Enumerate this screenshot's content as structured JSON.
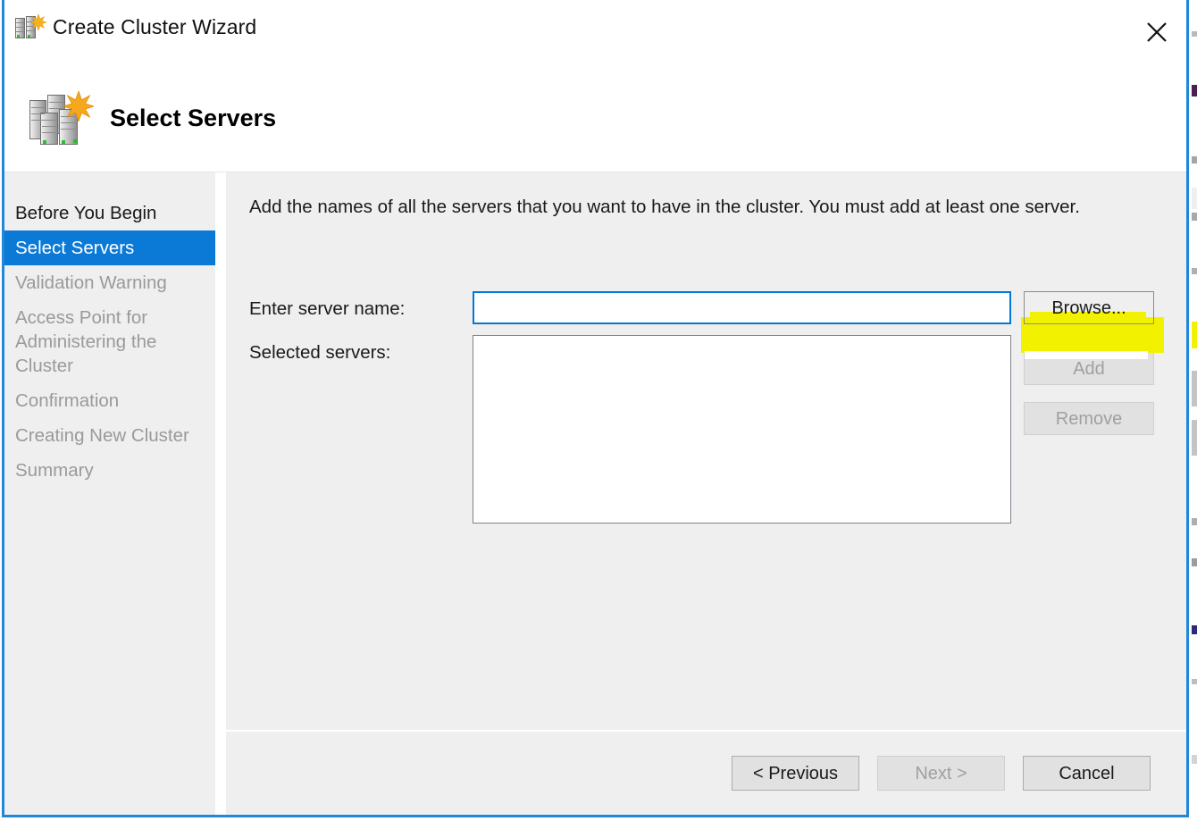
{
  "window": {
    "title": "Create Cluster Wizard",
    "title_icon": "cluster-servers-icon",
    "close_icon": "close-icon",
    "border_color": "#1f89d8"
  },
  "banner": {
    "heading": "Select Servers",
    "icon": "cluster-servers-large-icon"
  },
  "sidebar": {
    "items": [
      {
        "label": "Before You Begin",
        "state": "done"
      },
      {
        "label": "Select Servers",
        "state": "current"
      },
      {
        "label": "Validation Warning",
        "state": "pending"
      },
      {
        "label": "Access Point for Administering the Cluster",
        "state": "pending"
      },
      {
        "label": "Confirmation",
        "state": "pending"
      },
      {
        "label": "Creating New Cluster",
        "state": "pending"
      },
      {
        "label": "Summary",
        "state": "pending"
      }
    ],
    "selected_background": "#0b7ad6",
    "background": "#efeff0"
  },
  "content": {
    "instruction": "Add the names of all the servers that you want to have in the cluster. You must add at least one server.",
    "server_name": {
      "label": "Enter server name:",
      "value": "",
      "placeholder": "",
      "focused": true,
      "focus_color": "#0078d7"
    },
    "selected_servers": {
      "label": "Selected servers:",
      "items": []
    },
    "buttons": {
      "browse": "Browse...",
      "add": "Add",
      "remove": "Remove"
    },
    "disabled_buttons": [
      "Add",
      "Remove"
    ]
  },
  "annotation": {
    "type": "highlighter",
    "target": "Browse...",
    "color": "#f2f200"
  },
  "footer": {
    "previous": "< Previous",
    "next": "Next >",
    "cancel": "Cancel",
    "disabled_buttons": [
      "Next >"
    ]
  }
}
